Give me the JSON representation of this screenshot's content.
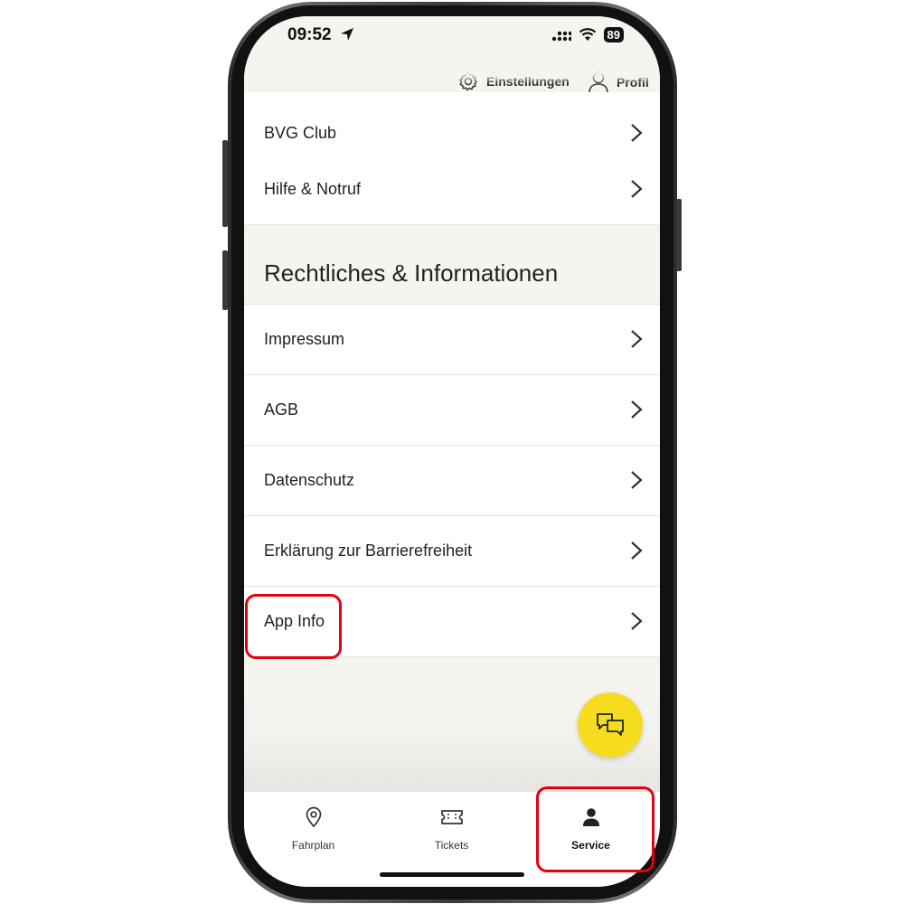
{
  "status_bar": {
    "time": "09:52",
    "battery": "89"
  },
  "header": {
    "settings_label": "Einstellungen",
    "profile_label": "Profil"
  },
  "list_top": [
    {
      "label": "BVG Club"
    },
    {
      "label": "Hilfe & Notruf"
    }
  ],
  "section": {
    "title": "Rechtliches & Informationen",
    "items": [
      {
        "label": "Impressum"
      },
      {
        "label": "AGB"
      },
      {
        "label": "Datenschutz"
      },
      {
        "label": "Erklärung zur Barrierefreiheit"
      },
      {
        "label": "App Info"
      }
    ]
  },
  "fab": {
    "icon": "chat-bubbles-icon"
  },
  "tabbar": {
    "tabs": [
      {
        "label": "Fahrplan",
        "icon": "map-pin-icon",
        "active": false
      },
      {
        "label": "Tickets",
        "icon": "ticket-icon",
        "active": false
      },
      {
        "label": "Service",
        "icon": "person-icon",
        "active": true
      }
    ]
  },
  "colors": {
    "accent_yellow": "#f5dc1e",
    "annotation_red": "#e3000f",
    "background_beige": "#f6f4ef"
  }
}
